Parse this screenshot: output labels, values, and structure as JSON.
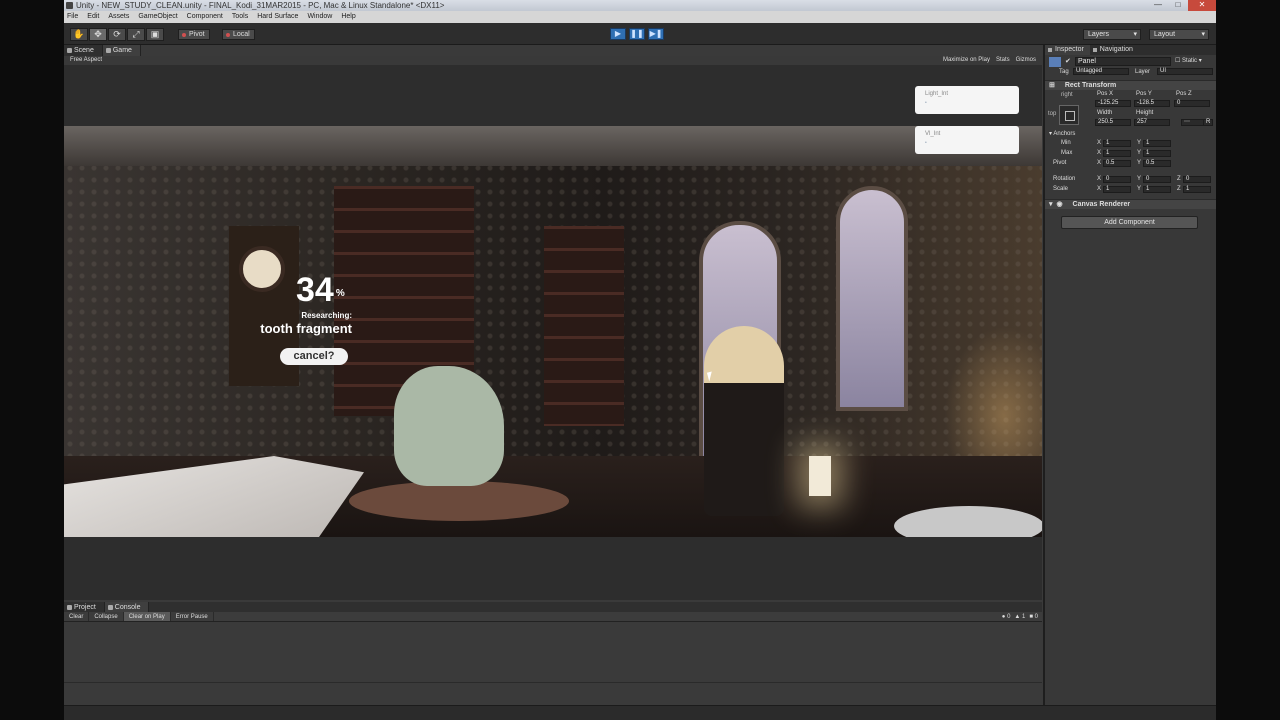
{
  "window": {
    "title": "Unity - NEW_STUDY_CLEAN.unity - FINAL_Kodi_31MAR2015 - PC, Mac & Linux Standalone* <DX11>",
    "controls": [
      "—",
      "□",
      "✕"
    ]
  },
  "menu": [
    "File",
    "Edit",
    "Assets",
    "GameObject",
    "Component",
    "Tools",
    "Hard Surface",
    "Window",
    "Help"
  ],
  "toolbar": {
    "tools": [
      "✋",
      "✥",
      "⟳",
      "⤢",
      "▣"
    ],
    "pivot_label": "Pivot",
    "local_label": "Local",
    "play_icons": [
      "▶",
      "❚❚",
      "▶❚"
    ],
    "layers_label": "Layers",
    "layout_label": "Layout"
  },
  "scene_tabs": {
    "scene": "Scene",
    "game": "Game"
  },
  "game_bar": {
    "aspect": "Free Aspect",
    "maximize": "Maximize on Play",
    "stats": "Stats",
    "gizmos": "Gizmos"
  },
  "hud": {
    "percent": "34",
    "percent_sign": "%",
    "researching": "Researching:",
    "item": "tooth fragment",
    "cancel": "cancel?"
  },
  "debug_boxes": [
    {
      "label": "Light_Int"
    },
    {
      "label": "Vl_Int"
    }
  ],
  "console": {
    "tabs": [
      "Project",
      "Console"
    ],
    "buttons": [
      "Clear",
      "Collapse",
      "Clear on Play",
      "Error Pause"
    ],
    "counts": {
      "log": "0",
      "warn": "1",
      "error": "0"
    }
  },
  "inspector": {
    "tabs": [
      "Inspector",
      "Navigation"
    ],
    "object_name": "Panel",
    "static_label": "Static",
    "tag_label": "Tag",
    "tag_value": "Untagged",
    "layer_label": "Layer",
    "layer_value": "UI",
    "rect_transform": "Rect Transform",
    "anchor_preset": "right",
    "side_label": "top",
    "pos_x_label": "Pos X",
    "pos_y_label": "Pos Y",
    "pos_z_label": "Pos Z",
    "pos_x": "-125.25",
    "pos_y": "-128.5",
    "pos_z": "0",
    "width_label": "Width",
    "height_label": "Height",
    "width": "250.5",
    "height": "257",
    "anchors_label": "Anchors",
    "min_label": "Min",
    "max_label": "Max",
    "pivot_label": "Pivot",
    "anchor_min_x": "1",
    "anchor_min_y": "1",
    "anchor_max_x": "1",
    "anchor_max_y": "1",
    "pivot_x": "0.5",
    "pivot_y": "0.5",
    "rotation_label": "Rotation",
    "rotation_x": "0",
    "rotation_y": "0",
    "rotation_z": "0",
    "scale_label": "Scale",
    "scale_x": "1",
    "scale_y": "1",
    "scale_z": "1",
    "canvas_renderer": "Canvas Renderer",
    "add_component": "Add Component",
    "axis_x": "X",
    "axis_y": "Y",
    "axis_z": "Z",
    "raw_label": "R"
  }
}
